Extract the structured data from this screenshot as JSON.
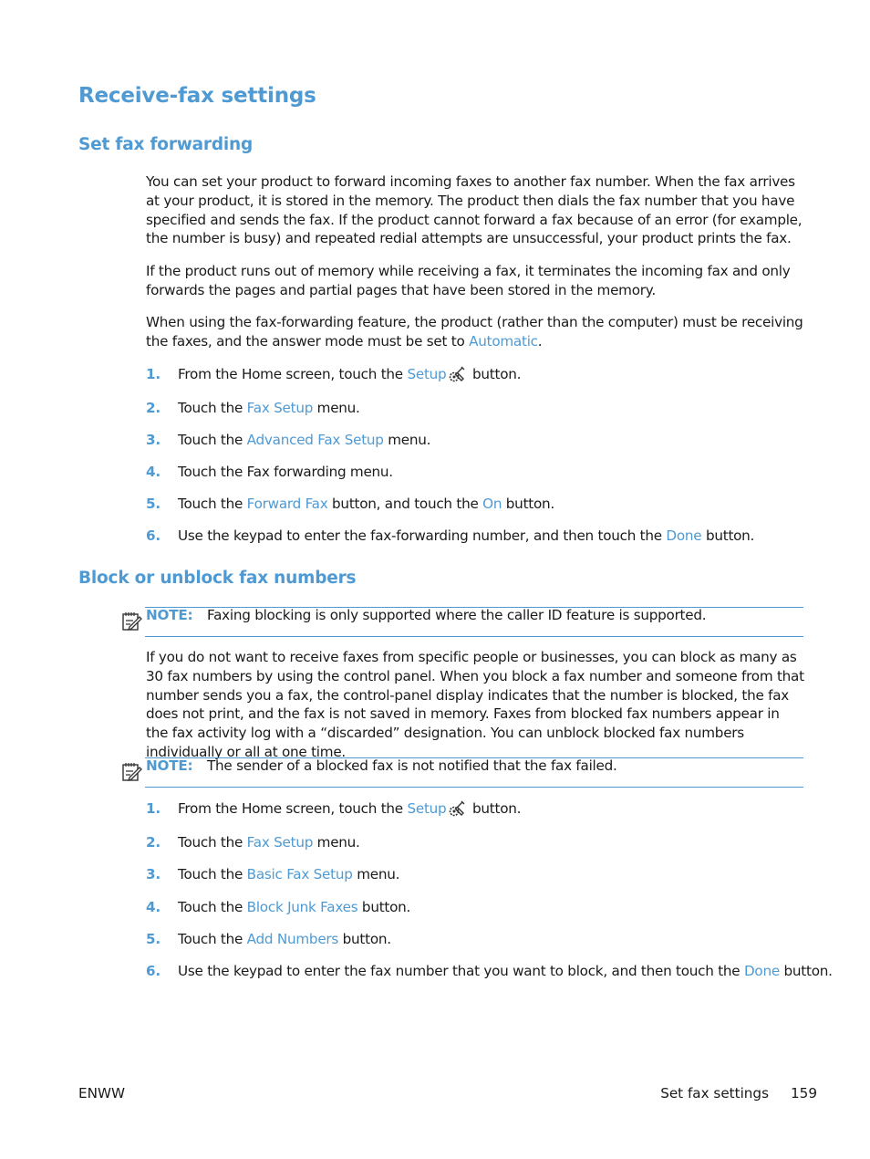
{
  "title": "Receive-fax settings",
  "sections": [
    {
      "heading": "Set fax forwarding",
      "paragraphs": [
        "You can set your product to forward incoming faxes to another fax number. When the fax arrives at your product, it is stored in the memory. The product then dials the fax number that you have specified and sends the fax. If the product cannot forward a fax because of an error (for example, the number is busy) and repeated redial attempts are unsuccessful, your product prints the fax.",
        "If the product runs out of memory while receiving a fax, it terminates the incoming fax and only forwards the pages and partial pages that have been stored in the memory."
      ],
      "para3": {
        "before": "When using the fax-forwarding feature, the product (rather than the computer) must be receiving the faxes, and the answer mode must be set to ",
        "link": "Automatic",
        "after": "."
      },
      "steps": [
        {
          "num": "1.",
          "a": "From the Home screen, touch the ",
          "link": "Setup",
          "icon": "setup-wrench-gear-icon",
          "b": " button."
        },
        {
          "num": "2.",
          "a": "Touch the ",
          "link": "Fax Setup",
          "b": " menu."
        },
        {
          "num": "3.",
          "a": "Touch the ",
          "link": "Advanced Fax Setup",
          "b": " menu."
        },
        {
          "num": "4.",
          "a": "Touch the Fax forwarding menu.",
          "link": "",
          "b": ""
        },
        {
          "num": "5.",
          "a": "Touch the ",
          "link": "Forward Fax",
          "b": " button, and touch the ",
          "link2": "On",
          "c": " button."
        },
        {
          "num": "6.",
          "a": "Use the keypad to enter the fax-forwarding number, and then touch the ",
          "link": "Done",
          "b": " button."
        }
      ]
    },
    {
      "heading": "Block or unblock fax numbers",
      "note1": {
        "label": "NOTE:",
        "text": "Faxing blocking is only supported where the caller ID feature is supported."
      },
      "paragraph": "If you do not want to receive faxes from specific people or businesses, you can block as many as 30 fax numbers by using the control panel. When you block a fax number and someone from that number sends you a fax, the control-panel display indicates that the number is blocked, the fax does not print, and the fax is not saved in memory. Faxes from blocked fax numbers appear in the fax activity log with a “discarded” designation. You can unblock blocked fax numbers individually or all at one time.",
      "note2": {
        "label": "NOTE:",
        "text": "The sender of a blocked fax is not notified that the fax failed."
      },
      "steps": [
        {
          "num": "1.",
          "a": "From the Home screen, touch the ",
          "link": "Setup",
          "icon": "setup-wrench-gear-icon",
          "b": " button."
        },
        {
          "num": "2.",
          "a": "Touch the ",
          "link": "Fax Setup",
          "b": " menu."
        },
        {
          "num": "3.",
          "a": "Touch the ",
          "link": "Basic Fax Setup",
          "b": " menu."
        },
        {
          "num": "4.",
          "a": "Touch the ",
          "link": "Block Junk Faxes",
          "b": " button."
        },
        {
          "num": "5.",
          "a": "Touch the ",
          "link": "Add Numbers",
          "b": " button."
        },
        {
          "num": "6.",
          "a": "Use the keypad to enter the fax number that you want to block, and then touch the ",
          "link": "Done",
          "b": " button."
        }
      ]
    }
  ],
  "footer": {
    "left": "ENWW",
    "section": "Set fax settings",
    "page": "159"
  }
}
